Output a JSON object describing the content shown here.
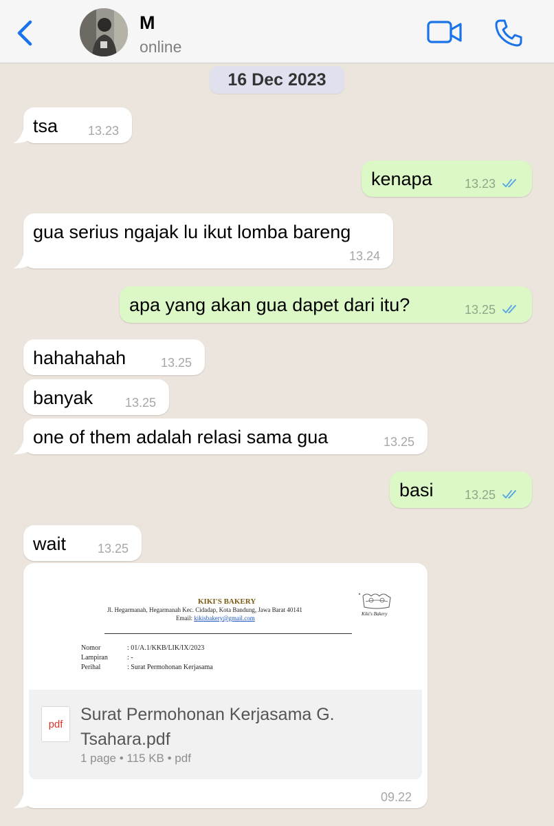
{
  "header": {
    "contact_name": "M",
    "status": "online"
  },
  "date_separator": "16 Dec 2023",
  "messages": [
    {
      "dir": "in",
      "text": "tsa",
      "time": "13.23"
    },
    {
      "dir": "out",
      "text": "kenapa",
      "time": "13.23",
      "read": true
    },
    {
      "dir": "in",
      "text": "gua serius ngajak lu ikut lomba bareng",
      "time": "13.24"
    },
    {
      "dir": "out",
      "text": "apa yang akan gua dapet dari itu?",
      "time": "13.25",
      "read": true
    },
    {
      "dir": "in",
      "text": "hahahahah",
      "time": "13.25"
    },
    {
      "dir": "in",
      "text": "banyak",
      "time": "13.25"
    },
    {
      "dir": "in",
      "text": "one of them adalah relasi sama gua",
      "time": "13.25"
    },
    {
      "dir": "out",
      "text": "basi",
      "time": "13.25",
      "read": true
    },
    {
      "dir": "in",
      "text": "wait",
      "time": "13.25"
    }
  ],
  "document": {
    "preview": {
      "company": "KIKI'S BAKERY",
      "address": "Jl. Hegarmanah, Hegarmanah Kec. Cidadap, Kota Bandung, Jawa Barat 40141",
      "email_label": "Email:",
      "email": "kikisbakery@gmail.com",
      "logo_caption": "Kiki's Bakery",
      "fields": [
        {
          "label": "Nomor",
          "value": ": 01/A.1/KKB/LIK/IX/2023"
        },
        {
          "label": "Lampiran",
          "value": ": -"
        },
        {
          "label": "Perihal",
          "value": ": Surat Permohonan Kerjasama"
        }
      ]
    },
    "icon_label": "pdf",
    "file_name": "Surat Permohonan Kerjasama G. Tsahara.pdf",
    "meta": "1 page • 115 KB • pdf",
    "time": "09.22"
  },
  "colors": {
    "background": "#ece5dd",
    "incoming": "#ffffff",
    "outgoing": "#dcf8c6",
    "accent": "#1a73e8",
    "read_ticks": "#4fa3e6"
  },
  "icons": {
    "back": "chevron-left-icon",
    "video": "video-camera-icon",
    "call": "phone-icon",
    "read": "double-check-icon",
    "file": "pdf-file-icon"
  }
}
